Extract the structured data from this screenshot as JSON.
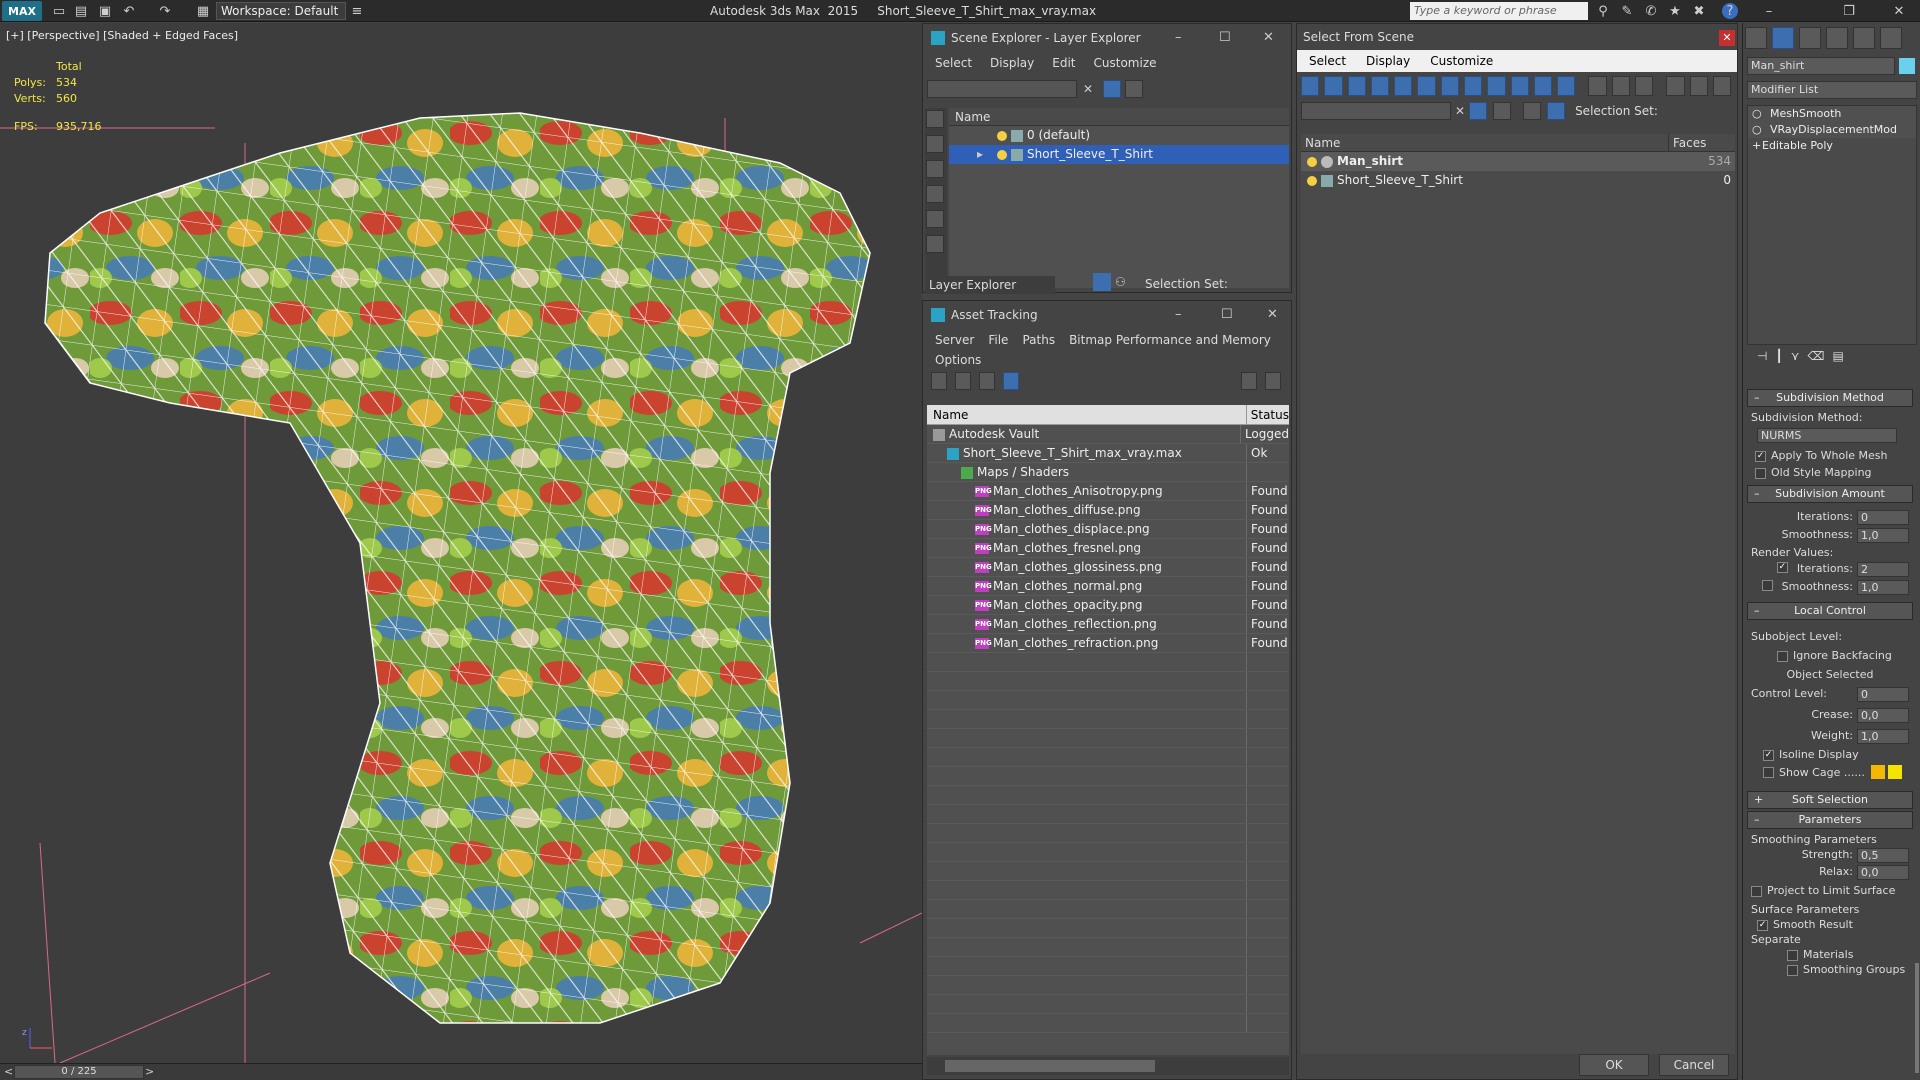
{
  "titlebar": {
    "logo": "MAX",
    "workspace": "Workspace: Default",
    "title": "Autodesk 3ds Max  2015     Short_Sleeve_T_Shirt_max_vray.max",
    "search_placeholder": "Type a keyword or phrase"
  },
  "viewport": {
    "label": "[+] [Perspective] [Shaded + Edged Faces]",
    "total": "Total",
    "polys_label": "Polys:",
    "polys_value": "534",
    "verts_label": "Verts:",
    "verts_value": "560",
    "fps_label": "FPS:",
    "fps_value": "935,716",
    "timeline": "0 / 225"
  },
  "scene_explorer": {
    "title": "Scene Explorer - Layer Explorer",
    "menu": [
      "Select",
      "Display",
      "Edit",
      "Customize"
    ],
    "col_name": "Name",
    "rows": [
      "0 (default)",
      "Short_Sleeve_T_Shirt"
    ],
    "footer_label": "Layer Explorer",
    "selection_set": "Selection Set:"
  },
  "asset_tracking": {
    "title": "Asset Tracking",
    "menu": [
      "Server",
      "File",
      "Paths",
      "Bitmap Performance and Memory"
    ],
    "menu2": "Options",
    "col_name": "Name",
    "col_status": "Status",
    "rows": [
      {
        "name": "Autodesk Vault",
        "status": "Logged",
        "indent": 0
      },
      {
        "name": "Short_Sleeve_T_Shirt_max_vray.max",
        "status": "Ok",
        "indent": 1
      },
      {
        "name": "Maps / Shaders",
        "status": "",
        "indent": 2
      },
      {
        "name": "Man_clothes_Anisotropy.png",
        "status": "Found",
        "indent": 3
      },
      {
        "name": "Man_clothes_diffuse.png",
        "status": "Found",
        "indent": 3
      },
      {
        "name": "Man_clothes_displace.png",
        "status": "Found",
        "indent": 3
      },
      {
        "name": "Man_clothes_fresnel.png",
        "status": "Found",
        "indent": 3
      },
      {
        "name": "Man_clothes_glossiness.png",
        "status": "Found",
        "indent": 3
      },
      {
        "name": "Man_clothes_normal.png",
        "status": "Found",
        "indent": 3
      },
      {
        "name": "Man_clothes_opacity.png",
        "status": "Found",
        "indent": 3
      },
      {
        "name": "Man_clothes_reflection.png",
        "status": "Found",
        "indent": 3
      },
      {
        "name": "Man_clothes_refraction.png",
        "status": "Found",
        "indent": 3
      }
    ]
  },
  "select_from_scene": {
    "title": "Select From Scene",
    "menu": [
      "Select",
      "Display",
      "Customize"
    ],
    "selection_set": "Selection Set:",
    "col_name": "Name",
    "col_faces": "Faces",
    "rows": [
      {
        "name": "Man_shirt",
        "faces": "534"
      },
      {
        "name": "Short_Sleeve_T_Shirt",
        "faces": "0"
      }
    ],
    "ok": "OK",
    "cancel": "Cancel"
  },
  "command_panel": {
    "object_name": "Man_shirt",
    "modifier_list": "Modifier List",
    "stack": [
      "MeshSmooth",
      "VRayDisplacementMod",
      "Editable Poly"
    ],
    "subdivision_method": {
      "header": "Subdivision Method",
      "label": "Subdivision Method:",
      "value": "NURMS",
      "apply_whole": "Apply To Whole Mesh",
      "old_style": "Old Style Mapping"
    },
    "subdivision_amount": {
      "header": "Subdivision Amount",
      "iterations_label": "Iterations:",
      "iterations_value": "0",
      "smoothness_label": "Smoothness:",
      "smoothness_value": "1,0",
      "render_values": "Render Values:",
      "r_iterations_label": "Iterations:",
      "r_iterations_value": "2",
      "r_smoothness_label": "Smoothness:",
      "r_smoothness_value": "1,0"
    },
    "local_control": {
      "header": "Local Control",
      "subobject": "Subobject Level:",
      "ignore_backfacing": "Ignore Backfacing",
      "object_selected": "Object Selected",
      "control_level_label": "Control Level:",
      "control_level_value": "0",
      "crease_label": "Crease:",
      "crease_value": "0,0",
      "weight_label": "Weight:",
      "weight_value": "1,0",
      "isoline": "Isoline Display",
      "show_cage": "Show Cage ......"
    },
    "soft_selection": "Soft Selection",
    "parameters": {
      "header": "Parameters",
      "smoothing": "Smoothing Parameters",
      "strength_label": "Strength:",
      "strength_value": "0,5",
      "relax_label": "Relax:",
      "relax_value": "0,0",
      "project": "Project to Limit Surface",
      "surface": "Surface Parameters",
      "smooth_result": "Smooth Result",
      "separate": "Separate",
      "materials": "Materials",
      "smoothing_groups": "Smoothing Groups"
    },
    "colors": {
      "cage1": "#f5b800",
      "cage2": "#f5e400"
    }
  }
}
